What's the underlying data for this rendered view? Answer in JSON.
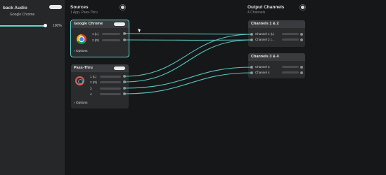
{
  "left_panel": {
    "title": "back Audio",
    "source_name": "Google Chrome",
    "volume_pct": "100%",
    "volume_value": 1.0
  },
  "sources": {
    "title": "Sources",
    "subtitle": "1 App, Pass-Thru"
  },
  "outputs": {
    "title": "Output Channels",
    "subtitle": "4 Channels"
  },
  "chrome_card": {
    "title": "Google Chrome",
    "channels": [
      "1 (L)",
      "2 (R)"
    ],
    "options_label": "› Options"
  },
  "passthru_card": {
    "title": "Pass-Thru",
    "channels": [
      "1 (L)",
      "2 (R)",
      "3",
      "4"
    ],
    "options_label": "› Options"
  },
  "out_card_1": {
    "title": "Channels 1 & 2",
    "channels": [
      "Channel 1 (L)",
      "Channel 2 (..."
    ]
  },
  "out_card_2": {
    "title": "Channels 3 & 4",
    "channels": [
      "Channel 3",
      "Channel 4"
    ]
  },
  "colors": {
    "accent": "#5fd7d2",
    "background": "#161718",
    "card": "#2a2b2d"
  }
}
